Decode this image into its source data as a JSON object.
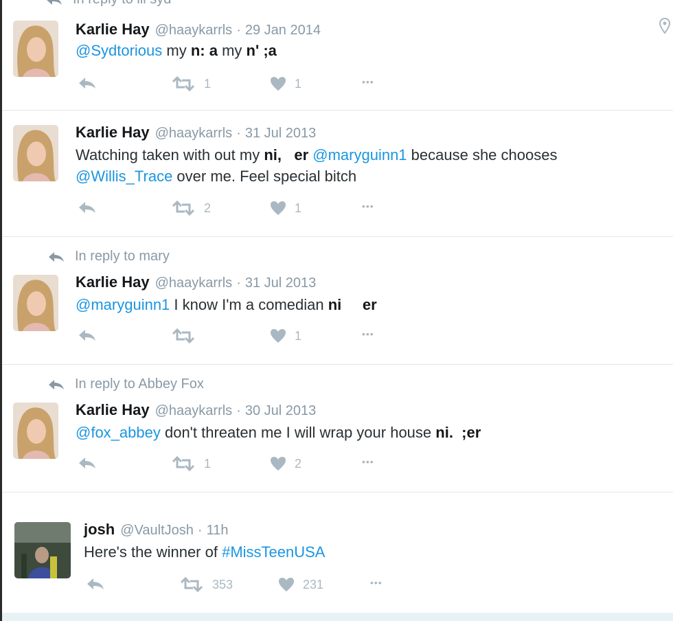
{
  "top_reply": "In reply to ill syd",
  "tweets": [
    {
      "reply_to": "",
      "name": "Karlie Hay",
      "handle": "@haaykarrls",
      "date": "29 Jan 2014",
      "text": {
        "mention1": "@Sydtorious",
        "t1": " my ",
        "b1": "n:",
        "t2": " ",
        "b2": "a",
        "t3": " my ",
        "b3": "n'",
        "t4": " ",
        "b4": ";a"
      },
      "retweets": "1",
      "likes": "1"
    },
    {
      "reply_to": "",
      "name": "Karlie Hay",
      "handle": "@haaykarrls",
      "date": "31 Jul 2013",
      "text": {
        "t1": "Watching taken with out my ",
        "b1": "ni,",
        "b2": "er",
        "mention1": "@maryguinn1",
        "t2": " because she chooses ",
        "mention2": "@Willis_Trace",
        "t3": " over me. Feel special bitch"
      },
      "retweets": "2",
      "likes": "1"
    },
    {
      "reply_to": "In reply to mary",
      "name": "Karlie Hay",
      "handle": "@haaykarrls",
      "date": "31 Jul 2013",
      "text": {
        "mention1": "@maryguinn1",
        "t1": " I know I'm a comedian ",
        "b1": "ni",
        "b2": "er"
      },
      "retweets": "",
      "likes": "1"
    },
    {
      "reply_to": "In reply to Abbey Fox",
      "name": "Karlie Hay",
      "handle": "@haaykarrls",
      "date": "30 Jul 2013",
      "text": {
        "mention1": "@fox_abbey",
        "t1": " don't threaten me I will wrap your house ",
        "b1": "ni.",
        "b2": ";er"
      },
      "retweets": "1",
      "likes": "2"
    },
    {
      "reply_to": "",
      "name": "josh",
      "handle": "@VaultJosh",
      "date": "11h",
      "text": {
        "t1": "Here's the winner of ",
        "hashtag": "#MissTeenUSA"
      },
      "retweets": "353",
      "likes": "231"
    }
  ],
  "dot": "·",
  "more": "•••",
  "icons": {
    "reply": "reply-arrow-icon",
    "retweet": "retweet-icon",
    "like": "heart-icon",
    "more": "more-dots-icon",
    "location": "location-pin-icon"
  },
  "colors": {
    "link": "#1b95e0",
    "muted": "#8899a6",
    "action": "#aab8c2",
    "divider": "#e1e8ed"
  }
}
